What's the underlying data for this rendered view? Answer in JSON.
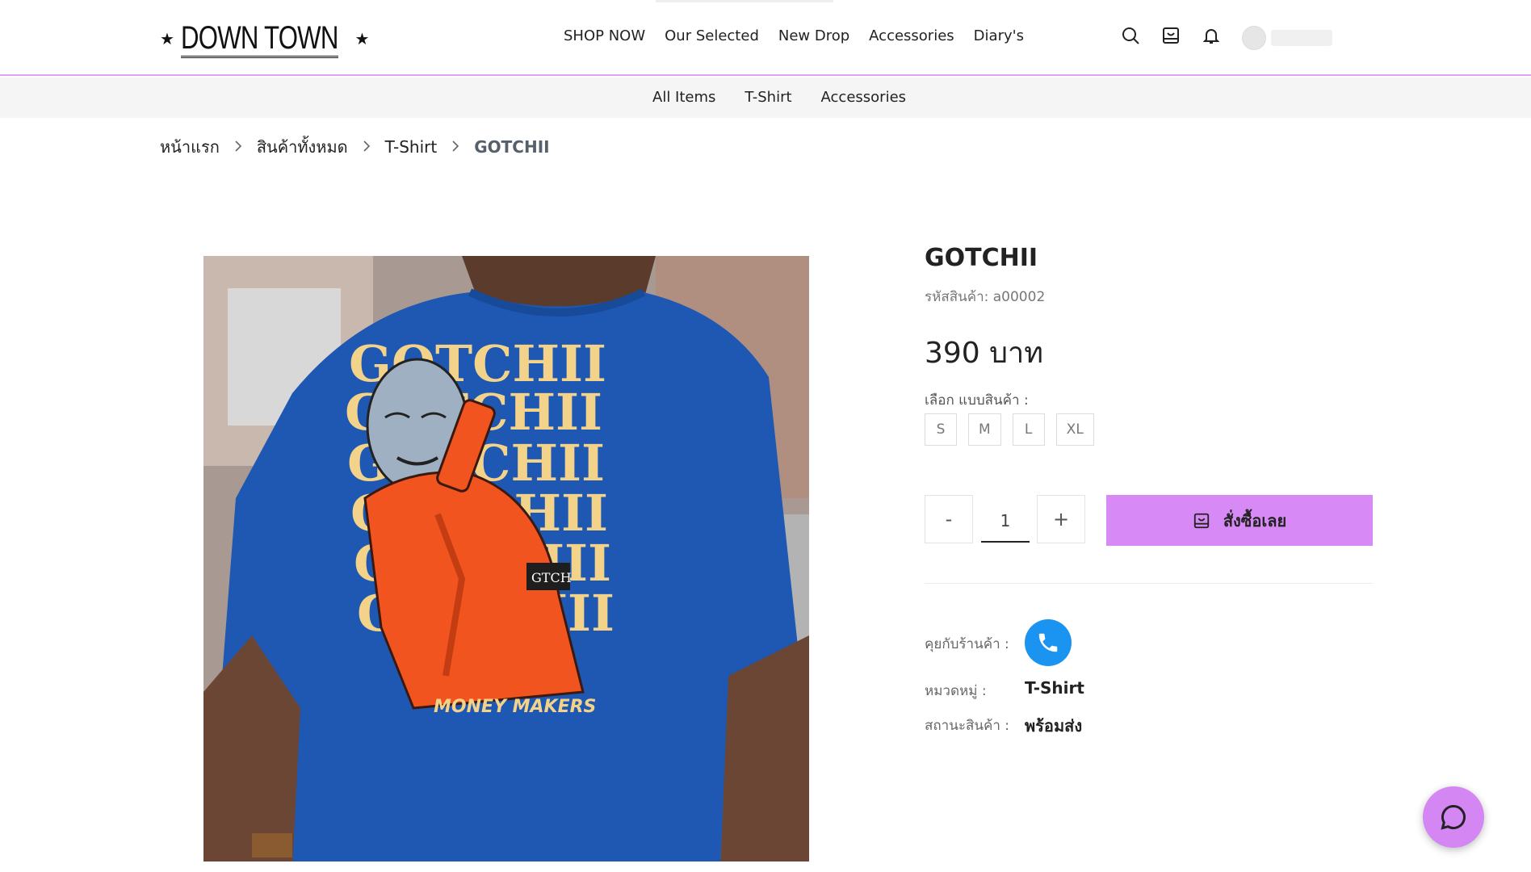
{
  "brand": {
    "logo_text": "DOWN TOWN",
    "logo_star": "★"
  },
  "header": {
    "nav": [
      "SHOP NOW",
      "Our Selected",
      "New Drop",
      "Accessories",
      "Diary's"
    ],
    "icons": [
      "search-icon",
      "cart-icon",
      "bell-icon"
    ]
  },
  "subnav": {
    "items": [
      "All Items",
      "T-Shirt",
      "Accessories"
    ]
  },
  "breadcrumb": {
    "items": [
      "หน้าแรก",
      "สินค้าทั้งหมด",
      "T-Shirt"
    ],
    "separator": ">",
    "current": "GOTCHII"
  },
  "product": {
    "title": "GOTCHII",
    "sku": "รหัสสินค้า: a00002",
    "price": "390 บาท",
    "variant_label": "เลือก แบบสินค้า :",
    "sizes": [
      "S",
      "M",
      "L",
      "XL"
    ],
    "quantity": "1",
    "qty_minus": "-",
    "qty_plus": "+",
    "buy_label": "สั่งซื้อเลย",
    "contact_label": "คุยกับร้านค้า :",
    "category_label": "หมวดหมู่ :",
    "category_value": "T-Shirt",
    "status_label": "สถานะสินค้า :",
    "status_value": "พร้อมส่ง",
    "image": {
      "print_lines": [
        "GOTCHII",
        "GOTCHII",
        "GOTCHII",
        "GOTCHII",
        "GOTCHII",
        "GOTCHII"
      ],
      "print_caption": "MONEY MAKERS",
      "shirt_color": "#1f58b3",
      "print_color": "#f3d28a",
      "jacket_color": "#f2541f"
    }
  },
  "colors": {
    "accent": "#d78af5",
    "header_border": "#d9a6ef",
    "call_button": "#1a94f0"
  }
}
